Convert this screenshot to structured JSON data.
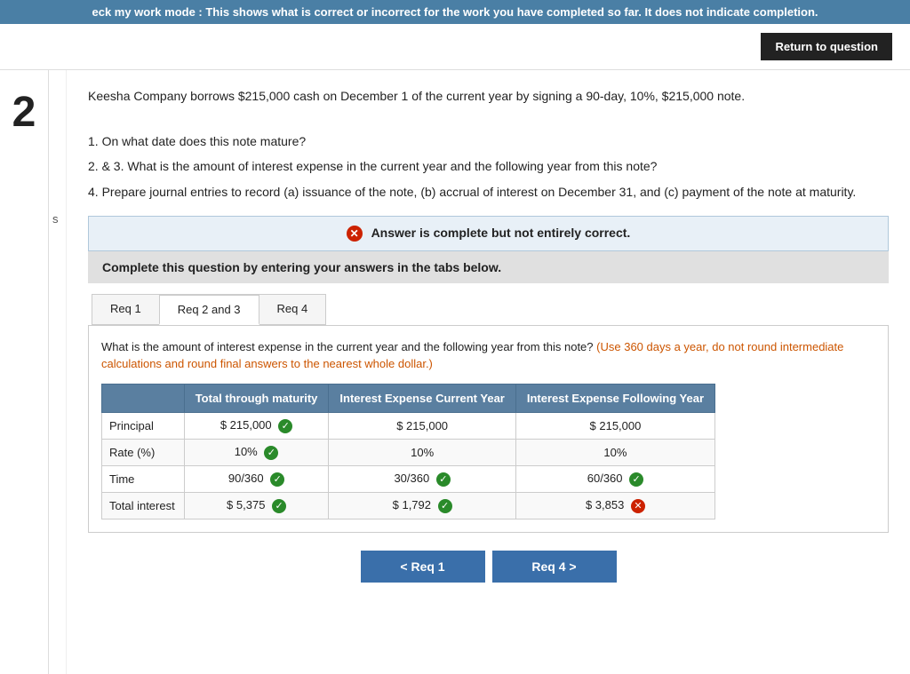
{
  "banner": {
    "text": "eck my work mode : This shows what is correct or incorrect for the work you have completed so far. It does not indicate completion."
  },
  "header": {
    "return_btn": "Return to question"
  },
  "question_number": "2",
  "sidebar_letter": "s",
  "question_body": {
    "intro": "Keesha Company borrows $215,000 cash on December 1 of the current year by signing a 90-day, 10%, $215,000 note.",
    "items": [
      "1. On what date does this note mature?",
      "2. & 3. What is the amount of interest expense in the current year and the following year from this note?",
      "4. Prepare journal entries to record (a) issuance of the note, (b) accrual of interest on December 31, and (c) payment of the note at maturity."
    ]
  },
  "answer_status": {
    "icon": "✕",
    "text": "Answer is complete but not entirely correct."
  },
  "instruction": "Complete this question by entering your answers in the tabs below.",
  "tabs": [
    {
      "label": "Req 1",
      "active": false
    },
    {
      "label": "Req 2 and 3",
      "active": true
    },
    {
      "label": "Req 4",
      "active": false
    }
  ],
  "tab_content": {
    "question_part1": "What is the amount of interest expense in the current year and the following year from this note?",
    "question_part2": "(Use 360 days a year, do not round intermediate calculations and round final answers to the nearest whole dollar.)",
    "table": {
      "headers": [
        "",
        "Total through maturity",
        "Interest Expense Current Year",
        "Interest Expense Following Year"
      ],
      "rows": [
        {
          "label": "Principal",
          "col1": "$ 215,000",
          "col1_check": "green",
          "col2": "$ 215,000",
          "col3": "$ 215,000"
        },
        {
          "label": "Rate (%)",
          "col1": "10%",
          "col1_check": "green",
          "col2": "10%",
          "col3": "10%"
        },
        {
          "label": "Time",
          "col1": "90/360",
          "col1_check": "green",
          "col2": "30/360",
          "col2_check": "green",
          "col3": "60/360",
          "col3_check": "green"
        },
        {
          "label": "Total interest",
          "col1": "$ 5,375",
          "col1_check": "green",
          "col2": "$ 1,792",
          "col2_check": "green",
          "col3": "$ 3,853",
          "col3_check": "red"
        }
      ]
    }
  },
  "nav_buttons": {
    "prev": "< Req 1",
    "next": "Req 4 >"
  }
}
